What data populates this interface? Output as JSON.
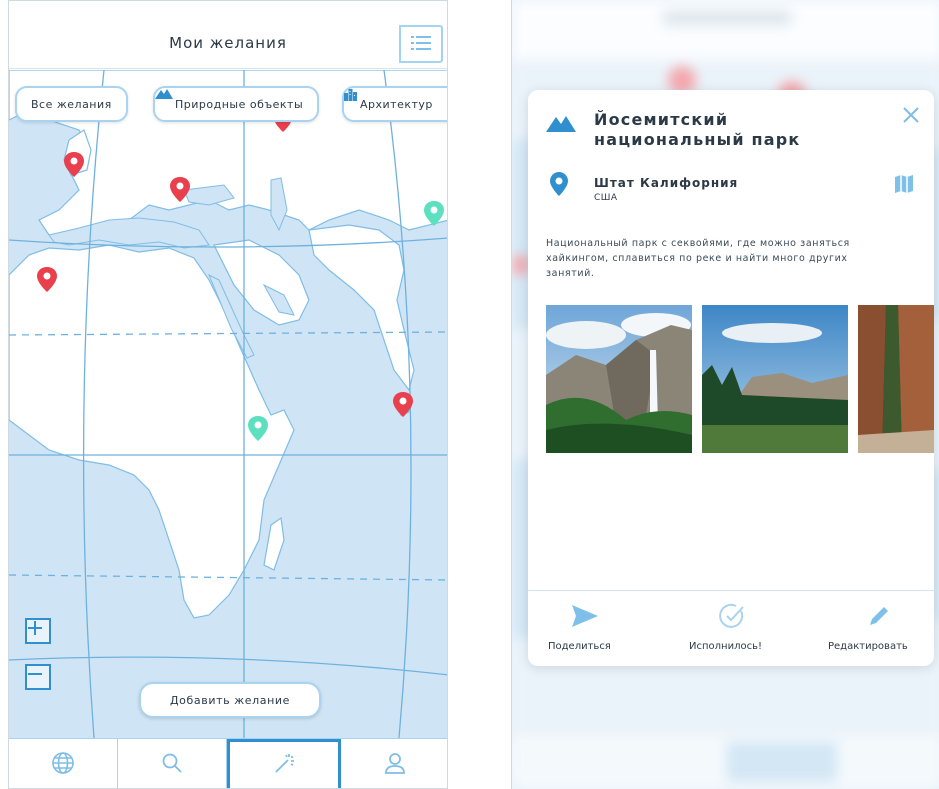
{
  "left": {
    "header_title": "Мои желания",
    "filters": [
      {
        "label": "Все желания",
        "icon": "none"
      },
      {
        "label": "Природные объекты",
        "icon": "mountain-icon"
      },
      {
        "label": "Архитектур",
        "icon": "building-icon"
      }
    ],
    "add_button": "Добавить желание",
    "zoom_in": "+",
    "zoom_out": "–",
    "nav": [
      {
        "icon": "globe-icon"
      },
      {
        "icon": "search-icon"
      },
      {
        "icon": "magic-wand-icon",
        "active": true
      },
      {
        "icon": "user-icon"
      }
    ]
  },
  "right": {
    "title": "Йосемитский национальный парк",
    "location": "Штат Калифорния",
    "country": "США",
    "description": "Национальный парк с секвойями, где можно заняться хайкингом, сплавиться по реке и найти много других занятий.",
    "actions": {
      "share": "Поделиться",
      "done": "Исполнилось!",
      "edit": "Редактировать"
    }
  },
  "colors": {
    "accent": "#2f8fcf",
    "light_accent": "#a9d3ef",
    "map_water": "#cfe5f5",
    "pin_red": "#e8404d",
    "pin_green": "#5ce0c0"
  }
}
